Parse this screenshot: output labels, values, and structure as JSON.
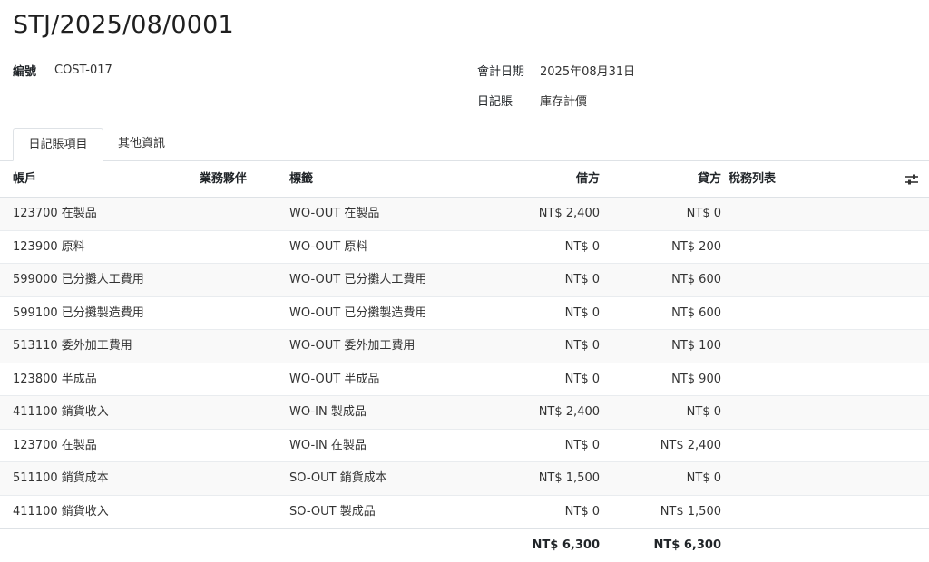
{
  "header": {
    "title": "STJ/2025/08/0001",
    "fields": {
      "code_label": "編號",
      "code_value": "COST-017",
      "date_label": "會計日期",
      "date_value": "2025年08月31日",
      "journal_label": "日記賬",
      "journal_value": "庫存計價"
    }
  },
  "tabs": [
    {
      "label": "日記賬項目",
      "active": true
    },
    {
      "label": "其他資訊",
      "active": false
    }
  ],
  "table": {
    "columns": {
      "account": "帳戶",
      "partner": "業務夥伴",
      "label": "標籤",
      "debit": "借方",
      "credit": "貸方",
      "taxes": "稅務列表"
    },
    "rows": [
      {
        "account": "123700 在製品",
        "partner": "",
        "label": "WO-OUT 在製品",
        "debit": "NT$ 2,400",
        "credit": "NT$ 0",
        "taxes": ""
      },
      {
        "account": "123900 原料",
        "partner": "",
        "label": "WO-OUT 原料",
        "debit": "NT$ 0",
        "credit": "NT$ 200",
        "taxes": ""
      },
      {
        "account": "599000 已分攤人工費用",
        "partner": "",
        "label": "WO-OUT 已分攤人工費用",
        "debit": "NT$ 0",
        "credit": "NT$ 600",
        "taxes": ""
      },
      {
        "account": "599100 已分攤製造費用",
        "partner": "",
        "label": "WO-OUT 已分攤製造費用",
        "debit": "NT$ 0",
        "credit": "NT$ 600",
        "taxes": ""
      },
      {
        "account": "513110 委外加工費用",
        "partner": "",
        "label": "WO-OUT 委外加工費用",
        "debit": "NT$ 0",
        "credit": "NT$ 100",
        "taxes": ""
      },
      {
        "account": "123800 半成品",
        "partner": "",
        "label": "WO-OUT 半成品",
        "debit": "NT$ 0",
        "credit": "NT$ 900",
        "taxes": ""
      },
      {
        "account": "411100 銷貨收入",
        "partner": "",
        "label": "WO-IN 製成品",
        "debit": "NT$ 2,400",
        "credit": "NT$ 0",
        "taxes": ""
      },
      {
        "account": "123700 在製品",
        "partner": "",
        "label": "WO-IN 在製品",
        "debit": "NT$ 0",
        "credit": "NT$ 2,400",
        "taxes": ""
      },
      {
        "account": "511100 銷貨成本",
        "partner": "",
        "label": "SO-OUT 銷貨成本",
        "debit": "NT$ 1,500",
        "credit": "NT$ 0",
        "taxes": ""
      },
      {
        "account": "411100 銷貨收入",
        "partner": "",
        "label": "SO-OUT 製成品",
        "debit": "NT$ 0",
        "credit": "NT$ 1,500",
        "taxes": ""
      }
    ],
    "totals": {
      "debit": "NT$ 6,300",
      "credit": "NT$ 6,300"
    }
  },
  "icons": {
    "column_settings": "sliders-icon"
  }
}
